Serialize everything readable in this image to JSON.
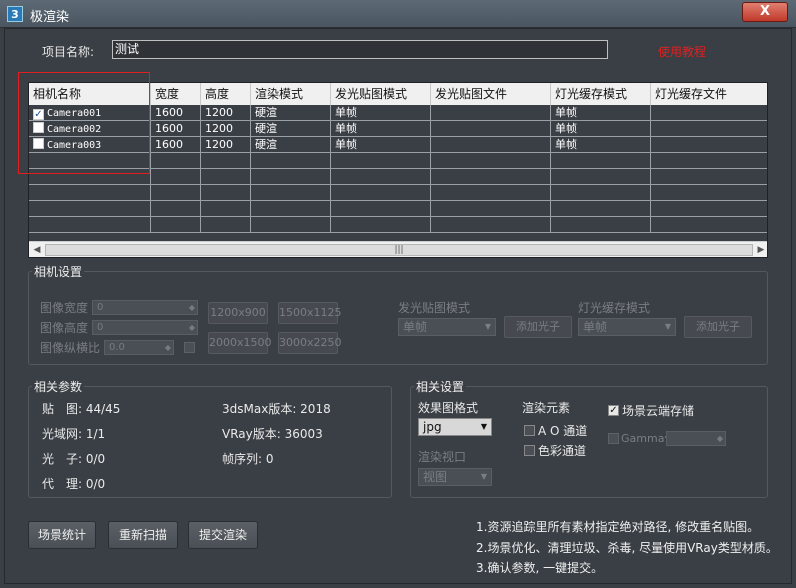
{
  "window": {
    "title": "极渲染",
    "icon_text": "3",
    "close_label": "X"
  },
  "project": {
    "label": "项目名称:",
    "value": "测试",
    "link": "使用教程"
  },
  "table": {
    "headers": [
      "相机名称",
      "宽度",
      "高度",
      "渲染模式",
      "发光贴图模式",
      "发光贴图文件",
      "灯光缓存模式",
      "灯光缓存文件"
    ],
    "rows": [
      {
        "checked": true,
        "name": "Camera001",
        "w": "1600",
        "h": "1200",
        "mode": "硬渲",
        "irr": "单帧",
        "irr_file": "",
        "lc": "单帧",
        "lc_file": ""
      },
      {
        "checked": false,
        "name": "Camera002",
        "w": "1600",
        "h": "1200",
        "mode": "硬渲",
        "irr": "单帧",
        "irr_file": "",
        "lc": "单帧",
        "lc_file": ""
      },
      {
        "checked": false,
        "name": "Camera003",
        "w": "1600",
        "h": "1200",
        "mode": "硬渲",
        "irr": "单帧",
        "irr_file": "",
        "lc": "单帧",
        "lc_file": ""
      }
    ],
    "scroll_grip": "|||"
  },
  "camera_settings": {
    "title": "相机设置",
    "width_label": "图像宽度",
    "width_value": "0",
    "height_label": "图像高度",
    "height_value": "0",
    "aspect_label": "图像纵横比",
    "aspect_value": "0.0",
    "preset1": "1200x900",
    "preset2": "1500x1125",
    "preset3": "2000x1500",
    "preset4": "3000x2250",
    "irr_mode_label": "发光贴图模式",
    "irr_mode_value": "单帧",
    "irr_add": "添加光子",
    "lc_mode_label": "灯光缓存模式",
    "lc_mode_value": "单帧",
    "lc_add": "添加光子"
  },
  "related_params": {
    "title": "相关参数",
    "maps": "贴　图: 44/45",
    "ies": "光域网: 1/1",
    "photon": "光　子: 0/0",
    "proxy": "代　理: 0/0",
    "max_version": "3dsMax版本: 2018",
    "vray_version": "VRay版本: 36003",
    "sequence": "帧序列: 0"
  },
  "related_settings": {
    "title": "相关设置",
    "format_label": "效果图格式",
    "format_value": "jpg",
    "viewport_label": "渲染视口",
    "viewport_value": "视图",
    "elements_label": "渲染元素",
    "ao_label": "A O 通道",
    "color_label": "色彩通道",
    "cloud_label": "场景云端存储",
    "gamma_label": "Gamma值"
  },
  "buttons": {
    "stats": "场景统计",
    "rescan": "重新扫描",
    "submit": "提交渲染"
  },
  "tips": [
    "1.资源追踪里所有素材指定绝对路径, 修改重名贴图。",
    "2.场景优化、清理垃圾、杀毒, 尽量使用VRay类型材质。",
    "3.确认参数, 一键提交。"
  ]
}
